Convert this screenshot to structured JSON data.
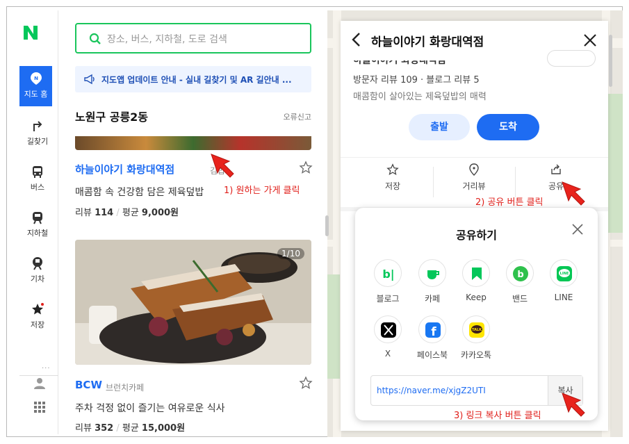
{
  "nav": {
    "items": [
      {
        "label": "지도 홈",
        "icon": "map-pin-icon",
        "active": true
      },
      {
        "label": "길찾기",
        "icon": "directions-icon",
        "active": false
      },
      {
        "label": "버스",
        "icon": "bus-icon",
        "active": false
      },
      {
        "label": "지하철",
        "icon": "subway-icon",
        "active": false
      },
      {
        "label": "기차",
        "icon": "train-icon",
        "active": false
      },
      {
        "label": "저장",
        "icon": "star-icon",
        "active": false
      }
    ],
    "more": "···"
  },
  "search": {
    "placeholder": "장소, 버스, 지하철, 도로 검색"
  },
  "notice": {
    "text": "지도앱 업데이트 안내 - 실내 길찾기 및 AR 길안내 ..."
  },
  "list": {
    "area_title": "노원구 공릉2동",
    "report": "오류신고",
    "stores": [
      {
        "name": "하늘이야기 화랑대역점",
        "category": "김밥",
        "desc": "매콤함 속 건강함 담은 제육덮밥",
        "review_label": "리뷰",
        "review_count": "114",
        "avg_label": "평균",
        "avg_price": "9,000원"
      },
      {
        "name": "BCW",
        "category": "브런치카페",
        "desc": "주차 걱정 없이 즐기는 여유로운 식사",
        "review_label": "리뷰",
        "review_count": "352",
        "avg_label": "평균",
        "avg_price": "15,000원",
        "photo_count": "1/10"
      }
    ]
  },
  "detail": {
    "title": "하늘이야기 화랑대역점",
    "ghost_title": "하늘이야기 화랑대역점",
    "visits": "방문자 리뷰 109 · 블로그 리뷰 5",
    "tagline": "매콤함이 살아있는 제육덮밥의 매력",
    "start": "출발",
    "arrive": "도착",
    "actions": [
      {
        "label": "저장",
        "icon": "star-outline-icon"
      },
      {
        "label": "거리뷰",
        "icon": "location-icon"
      },
      {
        "label": "공유",
        "icon": "share-icon"
      }
    ]
  },
  "share": {
    "title": "공유하기",
    "items": [
      {
        "label": "블로그",
        "icon": "blog-icon",
        "color": "#03c75a"
      },
      {
        "label": "카페",
        "icon": "cafe-icon",
        "color": "#03c75a"
      },
      {
        "label": "Keep",
        "icon": "keep-icon",
        "color": "#03c75a"
      },
      {
        "label": "밴드",
        "icon": "band-icon",
        "color": "#2ec14c"
      },
      {
        "label": "LINE",
        "icon": "line-icon",
        "color": "#06c755"
      },
      {
        "label": "X",
        "icon": "x-icon",
        "color": "#000000"
      },
      {
        "label": "페이스북",
        "icon": "facebook-icon",
        "color": "#1877f2"
      },
      {
        "label": "카카오톡",
        "icon": "kakaotalk-icon",
        "color": "#fee500"
      }
    ],
    "url": "https://naver.me/xjgZ2UTI",
    "copy": "복사"
  },
  "annotations": {
    "step1": "1) 원하는 가게 클릭",
    "step2": "2) 공유 버튼 클릭",
    "step3": "3) 링크 복사 버튼 클릭"
  },
  "colors": {
    "accent": "#1e6cf2",
    "naver_green": "#03c75a",
    "annotation": "#e0201b"
  }
}
